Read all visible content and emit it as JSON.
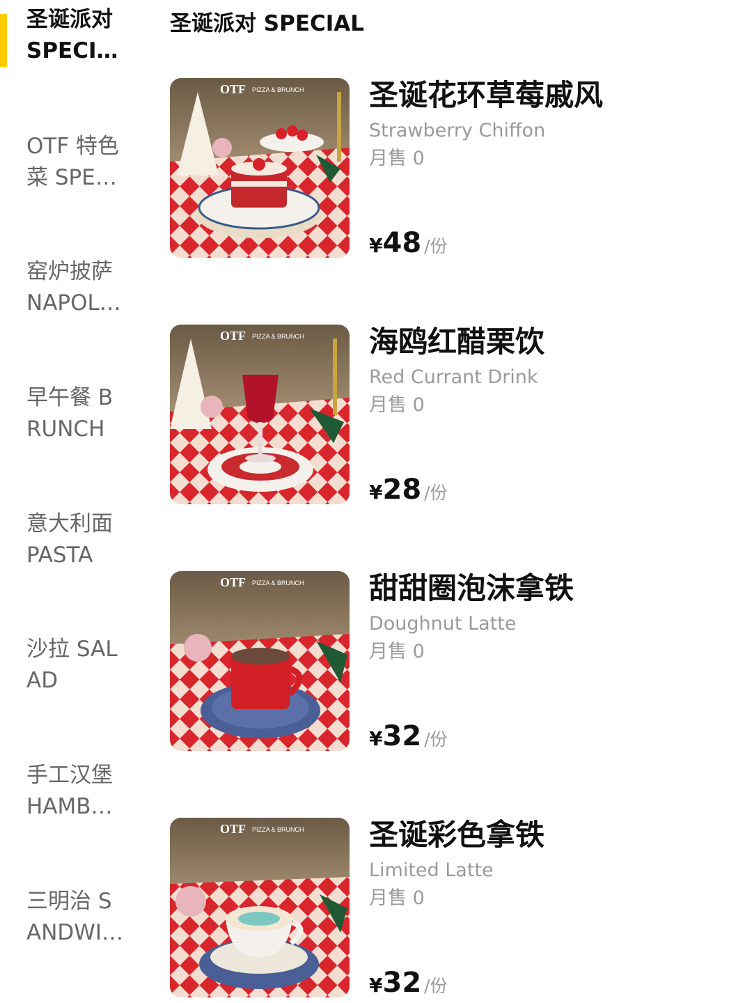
{
  "sidebar": {
    "categories": [
      {
        "label": "圣诞派对 SPECIAL",
        "active": true
      },
      {
        "label": "OTF 特色菜 SPECIAL"
      },
      {
        "label": "窑炉披萨 NAPOLI PIZZA"
      },
      {
        "label": "早午餐 BRUNCH"
      },
      {
        "label": "意大利面 PASTA"
      },
      {
        "label": "沙拉 SALAD"
      },
      {
        "label": "手工汉堡 HAMBURGER"
      },
      {
        "label": "三明治 SANDWICH"
      }
    ]
  },
  "main": {
    "section_title": "圣诞派对 SPECIAL",
    "items": [
      {
        "name": "圣诞花环草莓戚风",
        "en": "Strawberry Chiffon",
        "sales": "月售 0",
        "currency": "¥",
        "price": "48",
        "unit": "/份",
        "thumb_icon": "strawberry-cake-icon"
      },
      {
        "name": "海鸥红醋栗饮",
        "en": "Red Currant Drink",
        "sales": "月售 0",
        "currency": "¥",
        "price": "28",
        "unit": "/份",
        "thumb_icon": "red-drink-glass-icon"
      },
      {
        "name": "甜甜圈泡沫拿铁",
        "en": "Doughnut Latte",
        "sales": "月售 0",
        "currency": "¥",
        "price": "32",
        "unit": "/份",
        "thumb_icon": "red-mug-icon"
      },
      {
        "name": "圣诞彩色拿铁",
        "en": "Limited Latte",
        "sales": "月售 0",
        "currency": "¥",
        "price": "32",
        "unit": "/份",
        "thumb_icon": "latte-cup-icon"
      }
    ],
    "brand_label": "OTF",
    "brand_sub": "PIZZA & BRUNCH"
  },
  "colors": {
    "accent": "#ffcc00",
    "tablecloth_red": "#d8262c",
    "tablecloth_light": "#f3ddd0"
  }
}
